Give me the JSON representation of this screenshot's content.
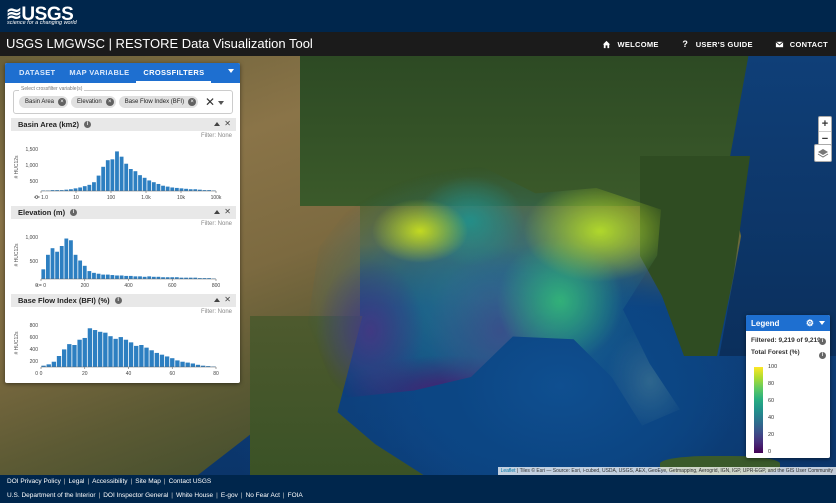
{
  "usgs": {
    "logo": "≋USGS",
    "tagline": "science for a changing world"
  },
  "header": {
    "title": "USGS LMGWSC | RESTORE Data Visualization Tool",
    "nav": [
      {
        "label": "WELCOME",
        "icon": "home-icon"
      },
      {
        "label": "USER'S GUIDE",
        "icon": "question-icon"
      },
      {
        "label": "CONTACT",
        "icon": "mail-icon"
      }
    ]
  },
  "panel": {
    "tabs": [
      "DATASET",
      "MAP VARIABLE",
      "CROSSFILTERS"
    ],
    "active_tab": "CROSSFILTERS",
    "select_label": "Select crossfilter variable(s)",
    "chips": [
      "Basin Area",
      "Elevation",
      "Base Flow Index (BFI)"
    ],
    "clear": "✕",
    "cards": [
      {
        "title": "Basin Area (km2)",
        "filter": "Filter: None",
        "ylabel": "# HUC12s",
        "yticks": [
          "1,500",
          "1,000",
          "500",
          "0"
        ],
        "xticks": [
          "<= 1.0",
          "10",
          "100",
          "1.0k",
          "10k",
          "100k"
        ],
        "bars": [
          0.01,
          0.01,
          0.02,
          0.02,
          0.02,
          0.03,
          0.04,
          0.06,
          0.08,
          0.11,
          0.14,
          0.2,
          0.35,
          0.55,
          0.7,
          0.72,
          0.9,
          0.78,
          0.62,
          0.5,
          0.45,
          0.36,
          0.3,
          0.24,
          0.2,
          0.16,
          0.12,
          0.1,
          0.08,
          0.07,
          0.06,
          0.05,
          0.04,
          0.04,
          0.03,
          0.02,
          0.02,
          0.01
        ]
      },
      {
        "title": "Elevation (m)",
        "filter": "Filter: None",
        "ylabel": "# HUC12s",
        "yticks": [
          "1,000",
          "500",
          "0"
        ],
        "xticks": [
          "<= 0",
          "200",
          "400",
          "600",
          "800"
        ],
        "bars": [
          0.22,
          0.55,
          0.7,
          0.62,
          0.75,
          0.92,
          0.88,
          0.55,
          0.42,
          0.3,
          0.18,
          0.14,
          0.12,
          0.1,
          0.1,
          0.09,
          0.08,
          0.08,
          0.07,
          0.07,
          0.06,
          0.06,
          0.05,
          0.06,
          0.05,
          0.05,
          0.04,
          0.04,
          0.04,
          0.04,
          0.03,
          0.03,
          0.03,
          0.03,
          0.02,
          0.02,
          0.02,
          0.01
        ]
      },
      {
        "title": "Base Flow Index (BFI) (%)",
        "filter": "Filter: None",
        "ylabel": "# HUC12s",
        "yticks": [
          "800",
          "600",
          "400",
          "200",
          "0"
        ],
        "xticks": [
          "0",
          "20",
          "40",
          "60",
          "80"
        ],
        "bars": [
          0.03,
          0.06,
          0.12,
          0.25,
          0.4,
          0.52,
          0.5,
          0.62,
          0.66,
          0.88,
          0.84,
          0.8,
          0.78,
          0.7,
          0.64,
          0.68,
          0.62,
          0.56,
          0.48,
          0.5,
          0.44,
          0.38,
          0.32,
          0.28,
          0.24,
          0.2,
          0.15,
          0.12,
          0.1,
          0.08,
          0.05,
          0.03,
          0.02,
          0.01
        ]
      }
    ]
  },
  "legend": {
    "title": "Legend",
    "filtered": "Filtered: 9,219 of 9,219",
    "variable": "Total Forest (%)",
    "ticks": [
      "100",
      "80",
      "60",
      "40",
      "20",
      "0"
    ],
    "colors": [
      "#440154",
      "#3b528b",
      "#21918c",
      "#5ec962",
      "#fde725"
    ]
  },
  "map": {
    "attribution_link": "Leaflet",
    "attribution": " | Tiles © Esri — Source: Esri, i-cubed, USDA, USGS, AEX, GeoEye, Getmapping, Aerogrid, IGN, IGP, UPR-EGP, and the GIS User Community",
    "zoom_in": "+",
    "zoom_out": "−"
  },
  "footer": {
    "row1": [
      "DOI Privacy Policy",
      "Legal",
      "Accessibility",
      "Site Map",
      "Contact USGS"
    ],
    "row2": [
      "U.S. Department of the Interior",
      "DOI Inspector General",
      "White House",
      "E-gov",
      "No Fear Act",
      "FOIA"
    ]
  }
}
